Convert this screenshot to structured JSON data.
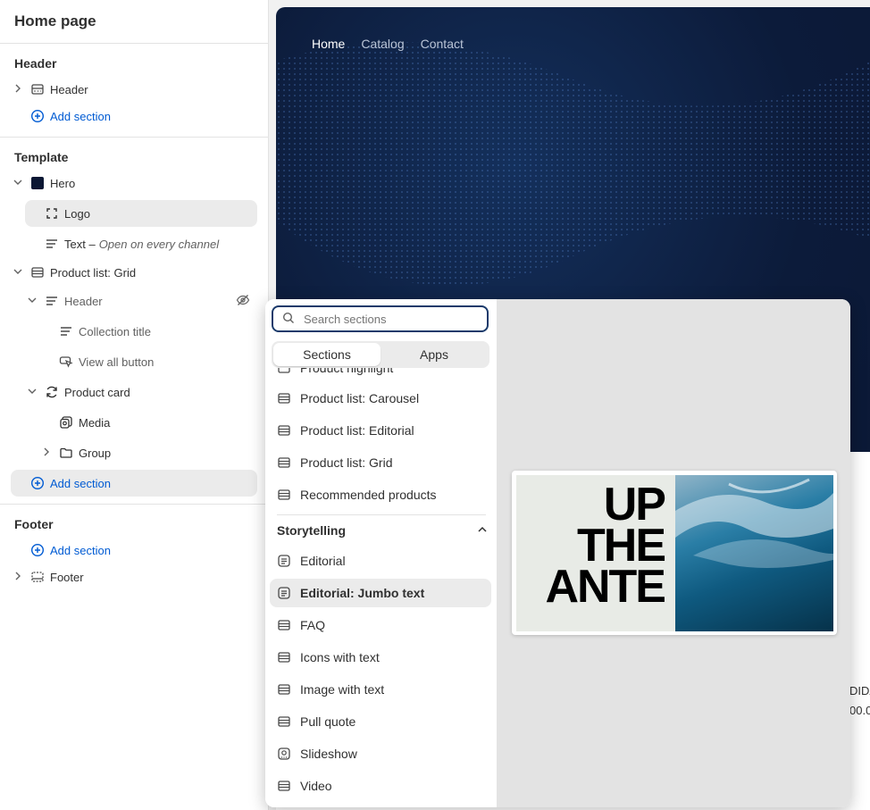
{
  "sidebar": {
    "title": "Home page",
    "header_section": {
      "title": "Header",
      "items": [
        {
          "label": "Header"
        }
      ],
      "add_label": "Add section"
    },
    "template_section": {
      "title": "Template",
      "hero": "Hero",
      "logo": "Logo",
      "text": "Text –",
      "text_note": "Open on every channel",
      "product_list": "Product list: Grid",
      "pl_header": "Header",
      "collection_title": "Collection title",
      "view_all": "View all button",
      "product_card": "Product card",
      "media": "Media",
      "group": "Group",
      "add_label": "Add section"
    },
    "footer_section": {
      "title": "Footer",
      "add_label": "Add section",
      "footer": "Footer"
    }
  },
  "preview": {
    "nav": [
      "Home",
      "Catalog",
      "Contact"
    ],
    "edge_text_1": "DIDA",
    "edge_text_2": "00.0"
  },
  "picker": {
    "search_placeholder": "Search sections",
    "tabs": [
      "Sections",
      "Apps"
    ],
    "partial_item": "Product highlight",
    "items_top": [
      "Product list: Carousel",
      "Product list: Editorial",
      "Product list: Grid",
      "Recommended products"
    ],
    "group": "Storytelling",
    "items_story": [
      "Editorial",
      "Editorial: Jumbo text",
      "FAQ",
      "Icons with text",
      "Image with text",
      "Pull quote",
      "Slideshow",
      "Video"
    ],
    "preview_text": [
      "UP",
      "THE",
      "ANTE"
    ]
  }
}
